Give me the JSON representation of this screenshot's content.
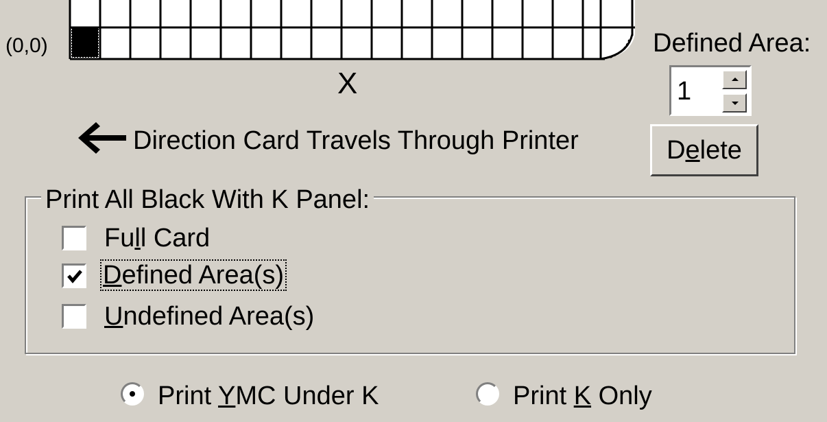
{
  "grid": {
    "origin_label": "(0,0)",
    "axis_label": "X"
  },
  "direction": {
    "label": "Direction Card Travels Through Printer"
  },
  "defined_area": {
    "label": "Defined Area:",
    "value": "1"
  },
  "delete_button": {
    "pre": "D",
    "accel": "e",
    "post": "lete"
  },
  "k_panel": {
    "title": "Print All Black With K Panel:",
    "full_card": {
      "pre": "Fu",
      "accel": "l",
      "post": "l Card",
      "checked": false
    },
    "defined_areas": {
      "pre": "",
      "accel": "D",
      "post": "efined Area(s)",
      "checked": true
    },
    "undefined_areas": {
      "pre": "",
      "accel": "U",
      "post": "ndefined Area(s)",
      "checked": false
    }
  },
  "print_mode": {
    "ymc_under_k": {
      "pre": "Print ",
      "accel": "Y",
      "post": "MC Under K",
      "selected": true
    },
    "k_only": {
      "pre": "Print ",
      "accel": "K",
      "post": " Only",
      "selected": false
    }
  }
}
